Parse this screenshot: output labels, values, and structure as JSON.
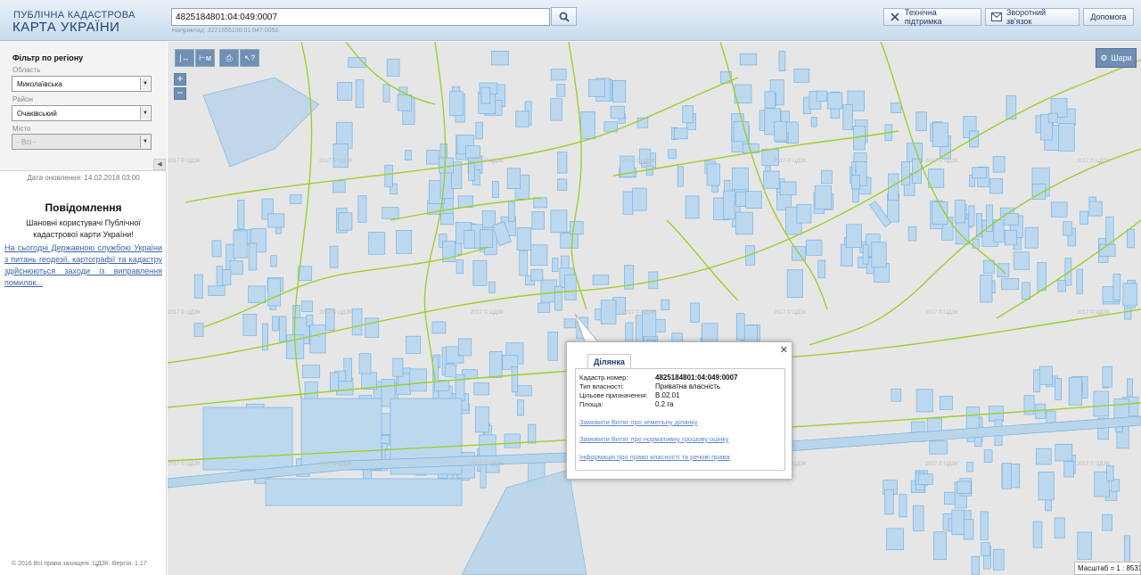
{
  "header": {
    "logo_top": "ПУБЛІЧНА КАДАСТРОВА",
    "logo_main": "КАРТА УКРАЇНИ",
    "search_value": "4825184801:04:049:0007",
    "search_hint": "Наприклад: 3221655100:01:047:0052",
    "support_label": "Технічна підтримка",
    "feedback_label": "Зворотний зв'язок",
    "help_label": "Допомога"
  },
  "sidebar": {
    "filter_title": "Фільтр по регіону",
    "region_label": "Область",
    "region_value": "Миколаївська",
    "district_label": "Район",
    "district_value": "Очаківський",
    "city_label": "Місто",
    "city_value": "- Всі -",
    "updated": "Дата оновлення: 14.02.2018 03:00",
    "notice_title": "Повідомлення",
    "notice_text": "Шановні користувачі Публічної кадастрової карти України!",
    "notice_link": "На сьогодні Державною службою України з питань геодезії, картографії та кадастру здійснюються заходи із виправлення помилок...",
    "copyright": "© 2016 Всі права захищені. ЦДЗК. Версія: 1.17"
  },
  "map": {
    "tools": [
      "|↔",
      "⊢м",
      "⎙",
      "↖?"
    ],
    "zoom_in": "+",
    "zoom_out": "−",
    "layers_label": "Шари",
    "scale_text": "Масштаб = 1 : 8531",
    "watermark": "2017 © ЦДЗК",
    "colors": {
      "parcel_fill": "#bcd8ef",
      "parcel_stroke": "#78b3e2",
      "boundary": "#9ecf2f",
      "background": "#e6e6e6"
    }
  },
  "popup": {
    "tab_label": "Ділянка",
    "rows": [
      {
        "label": "Кадастр.номер:",
        "value": "4825184801:04:049:0007"
      },
      {
        "label": "Тип власності:",
        "value": "Приватна власність"
      },
      {
        "label": "Цільове призначення:",
        "value": "В.02.01"
      },
      {
        "label": "Площа:",
        "value": "0.2 га"
      }
    ],
    "links": [
      "Замовити Витяг про земельну ділянку",
      "Замовити Витяг про нормативну грошову оцінку",
      "Інформація про право власності та речові права"
    ]
  }
}
